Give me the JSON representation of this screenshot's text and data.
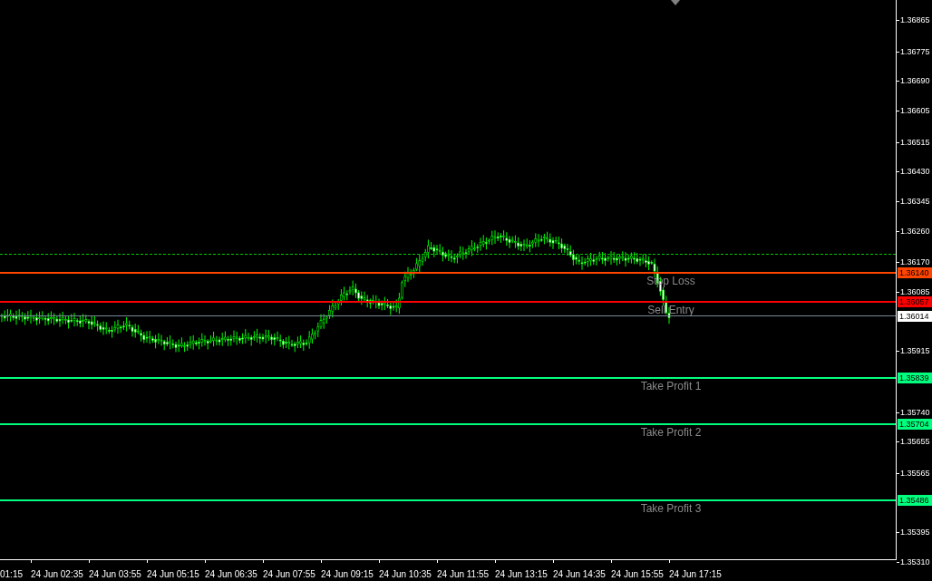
{
  "price_axis": {
    "ticks": [
      "1.36865",
      "1.36775",
      "1.36690",
      "1.36605",
      "1.36515",
      "1.36430",
      "1.36345",
      "1.36260",
      "1.36170",
      "1.36085",
      "1.35915",
      "1.35740",
      "1.35655",
      "1.35565",
      "1.35395",
      "1.35310"
    ]
  },
  "levels": [
    {
      "kind": "dashed",
      "color": "#00c800"
    },
    {
      "kind": "order",
      "label": "Stop Loss",
      "tag": "1.36140",
      "color": "#ff4500"
    },
    {
      "kind": "order",
      "label": "Sell Entry",
      "tag": "1.36057",
      "color": "#ff0000"
    },
    {
      "kind": "bid",
      "tag": "1.36014",
      "color": "#778899"
    },
    {
      "kind": "order",
      "label": "Take Profit 1",
      "tag": "1.35839",
      "color": "#00ff7f"
    },
    {
      "kind": "order",
      "label": "Take Profit 2",
      "tag": "1.35704",
      "color": "#00ff7f"
    },
    {
      "kind": "order",
      "label": "Take Profit 3",
      "tag": "1.35486",
      "color": "#00ff7f"
    }
  ],
  "time_axis": [
    "01:15",
    "24 Jun 02:35",
    "24 Jun 03:55",
    "24 Jun 05:15",
    "24 Jun 06:35",
    "24 Jun 07:55",
    "24 Jun 09:15",
    "24 Jun 10:35",
    "24 Jun 11:55",
    "24 Jun 13:15",
    "24 Jun 14:35",
    "24 Jun 15:55",
    "24 Jun 17:15"
  ]
}
